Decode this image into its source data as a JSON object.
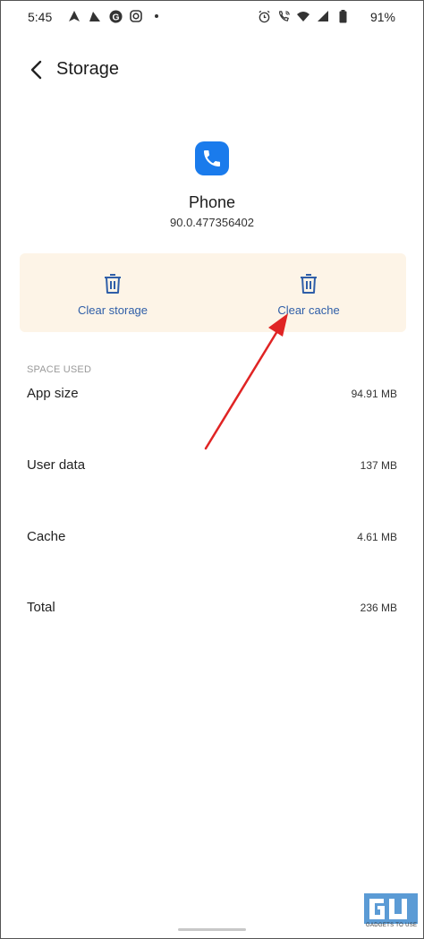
{
  "status_bar": {
    "time": "5:45",
    "battery": "91%",
    "left_icons": [
      "nav-arrow-icon",
      "nav-arrow-icon",
      "google-icon",
      "instagram-icon",
      "dot-icon"
    ],
    "right_icons": [
      "alarm-icon",
      "wifi-calling-icon",
      "wifi-icon",
      "signal-icon",
      "battery-icon"
    ]
  },
  "header": {
    "title": "Storage"
  },
  "app": {
    "name": "Phone",
    "version": "90.0.477356402",
    "icon": "phone-icon",
    "icon_color": "#1a7bec"
  },
  "actions": {
    "clear_storage": "Clear storage",
    "clear_cache": "Clear cache",
    "label_color": "#2f5ea8",
    "panel_color": "#fdf4e7"
  },
  "annotation": {
    "arrow_color": "#e02424"
  },
  "space": {
    "section_label": "SPACE USED",
    "rows": [
      {
        "label": "App size",
        "value": "94.91 MB"
      },
      {
        "label": "User data",
        "value": "137 MB"
      },
      {
        "label": "Cache",
        "value": "4.61 MB"
      },
      {
        "label": "Total",
        "value": "236 MB"
      }
    ]
  },
  "watermark": {
    "text": "GADGETS TO USE"
  }
}
